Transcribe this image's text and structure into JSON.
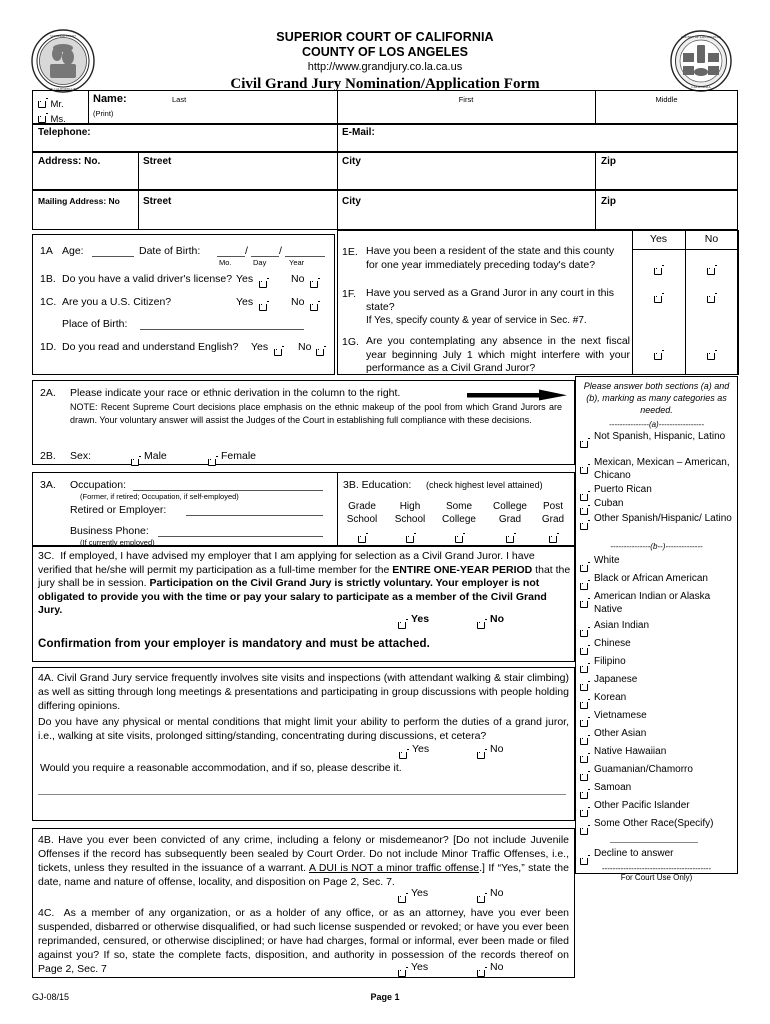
{
  "header": {
    "line1": "SUPERIOR COURT OF CALIFORNIA",
    "line2": "COUNTY OF LOS ANGELES",
    "url": "http://www.grandjury.co.la.ca.us",
    "title": "Civil Grand Jury Nomination/Application Form",
    "left_seal_name": "superior-court-seal",
    "right_seal_name": "county-of-los-angeles-seal"
  },
  "name_row": {
    "mr": "Mr.",
    "ms": "Ms.",
    "name_label": "Name:",
    "print_note": "(Print)",
    "last": "Last",
    "first": "First",
    "middle": "Middle"
  },
  "contact_row": {
    "telephone": "Telephone:",
    "email": "E-Mail:"
  },
  "address_row": {
    "address_no": "Address: No.",
    "street": "Street",
    "city": "City",
    "zip": "Zip"
  },
  "mailing_row": {
    "mailing_no": "Mailing Address: No",
    "street": "Street",
    "city": "City",
    "zip": "Zip"
  },
  "section1": {
    "yes_header": "Yes",
    "no_header": "No",
    "a_num": "1A",
    "a_age": "Age:",
    "a_dob": "Date of Birth:",
    "a_mo": "Mo.",
    "a_day": "Day",
    "a_year": "Year",
    "b_num": "1B.",
    "b_text": "Do you have a valid driver's license?",
    "b_yes": "Yes",
    "b_no": "No",
    "c_num": "1C.",
    "c_text": "Are you a U.S. Citizen?",
    "c_yes": "Yes",
    "c_no": "No",
    "c_pob": "Place of Birth:",
    "d_num": "1D.",
    "d_text": "Do you read and understand English?",
    "d_yes": "Yes",
    "d_no": "No",
    "e_num": "1E.",
    "e_text": "Have you been a resident of the state and this county for one year immediately preceding today's date?",
    "f_num": "1F.",
    "f_text": "Have you served as a Grand Juror in any court in this state?",
    "f_note": "If Yes, specify county & year of service in Sec. #7.",
    "g_num": "1G.",
    "g_text": "Are you contemplating any absence in the next fiscal year beginning July 1 which might interfere with your performance as a Civil Grand Juror?"
  },
  "section2": {
    "a_num": "2A.",
    "a_text": "Please indicate your race or ethnic derivation in the column to the right.",
    "a_note": "NOTE: Recent Supreme Court decisions place emphasis on the ethnic makeup of the pool from which Grand Jurors are drawn.  Your voluntary answer will assist the Judges of the Court in establishing full compliance with these decisions.",
    "b_num": "2B.",
    "b_label": "Sex:",
    "b_male": "Male",
    "b_female": "Female"
  },
  "ethnicity": {
    "instructions": "Please answer both sections (a) and (b), marking as many categories as needed.",
    "divider_a": "---------------(a)-----------------",
    "divider_b": "---------------(b--)--------------",
    "group_a": [
      "Not Spanish, Hispanic, Latino",
      "Mexican, Mexican – American, Chicano",
      "Puerto Rican",
      "Cuban",
      "Other Spanish/Hispanic/ Latino"
    ],
    "group_b": [
      "White",
      "Black or African American",
      "American Indian or Alaska Native",
      "Asian Indian",
      "Chinese",
      "Filipino",
      "Japanese",
      "Korean",
      "Vietnamese",
      "Other Asian",
      "Native Hawaiian",
      "Guamanian/Chamorro",
      "Samoan",
      "Other Pacific Islander",
      "Some Other Race(Specify)"
    ],
    "decline": "Decline to answer",
    "court_divider": "-----------------------------------------",
    "court_use": "For Court Use Only)"
  },
  "section3": {
    "a_num": "3A.",
    "a_occupation": "Occupation:",
    "a_occ_note": "(Former, if retired; Occupation, if self-employed)",
    "a_retired": "Retired or Employer:",
    "a_phone": "Business Phone:",
    "a_phone_note": "(If currently employed)",
    "b_label": "3B. Education:",
    "b_note": "(check highest level attained)",
    "b_levels": [
      {
        "l1": "Grade",
        "l2": "School"
      },
      {
        "l1": "High",
        "l2": "School"
      },
      {
        "l1": "Some",
        "l2": "College"
      },
      {
        "l1": "College",
        "l2": "Grad"
      },
      {
        "l1": "Post",
        "l2": "Grad"
      }
    ],
    "c_num": "3C.",
    "c_text_1": "If employed, I have advised my employer that I am applying for selection as a Civil Grand Juror. I have verified that he/she will permit my participation as a full-time member for the ",
    "c_bold_1": "ENTIRE ONE-YEAR PERIOD",
    "c_text_2": " that the jury shall be in session.  ",
    "c_bold_2": "Participation on the Civil Grand Jury is strictly voluntary. Your employer is not obligated to provide you with the time or pay your salary to participate as a member of the Civil Grand Jury.",
    "c_yes": "Yes",
    "c_no": "No",
    "c_confirm": "Confirmation from your employer is mandatory and must be attached."
  },
  "section4": {
    "a_num": "4A.",
    "a_text": "Civil Grand Jury service frequently involves site visits and inspections (with attendant walking & stair climbing) as well as sitting through long meetings & presentations and participating in group discussions with people holding differing opinions.",
    "a_q": "Do you have any physical or mental conditions that might limit your ability to perform the duties of a grand juror, i.e., walking at site visits, prolonged sitting/standing, concentrating during discussions, et cetera?",
    "a_yes": "Yes",
    "a_no": "No",
    "a_accom": "Would you require a reasonable accommodation, and if so, please describe it.",
    "b_num": "4B.",
    "b_text_1": "Have you ever been convicted of any crime, including a felony or misdemeanor?  [Do not include Juvenile Offenses if the record has subsequently been sealed by Court Order.  Do not include Minor Traffic Offenses, i.e., tickets, unless they resulted in the issuance of a warrant.  ",
    "b_underline": "A DUI is NOT a minor traffic offense",
    "b_text_2": ".]  If “Yes,” state the date, name and nature of offense, locality, and disposition on Page 2, Sec. 7.",
    "b_yes": "Yes",
    "b_no": "No",
    "c_num": "4C.",
    "c_text": "As a member of any organization, or as a holder of any office, or as an attorney, have you ever been suspended, disbarred or otherwise disqualified, or had such license suspended or revoked; or have you ever been reprimanded, censured, or otherwise disciplined; or have had charges, formal or informal, ever been made or filed against you?  If so, state the complete facts, disposition, and authority in possession of the records thereof on Page 2, Sec. 7",
    "c_yes": "Yes",
    "c_no": "No"
  },
  "footer": {
    "form_id": "GJ-08/15",
    "page": "Page 1"
  }
}
